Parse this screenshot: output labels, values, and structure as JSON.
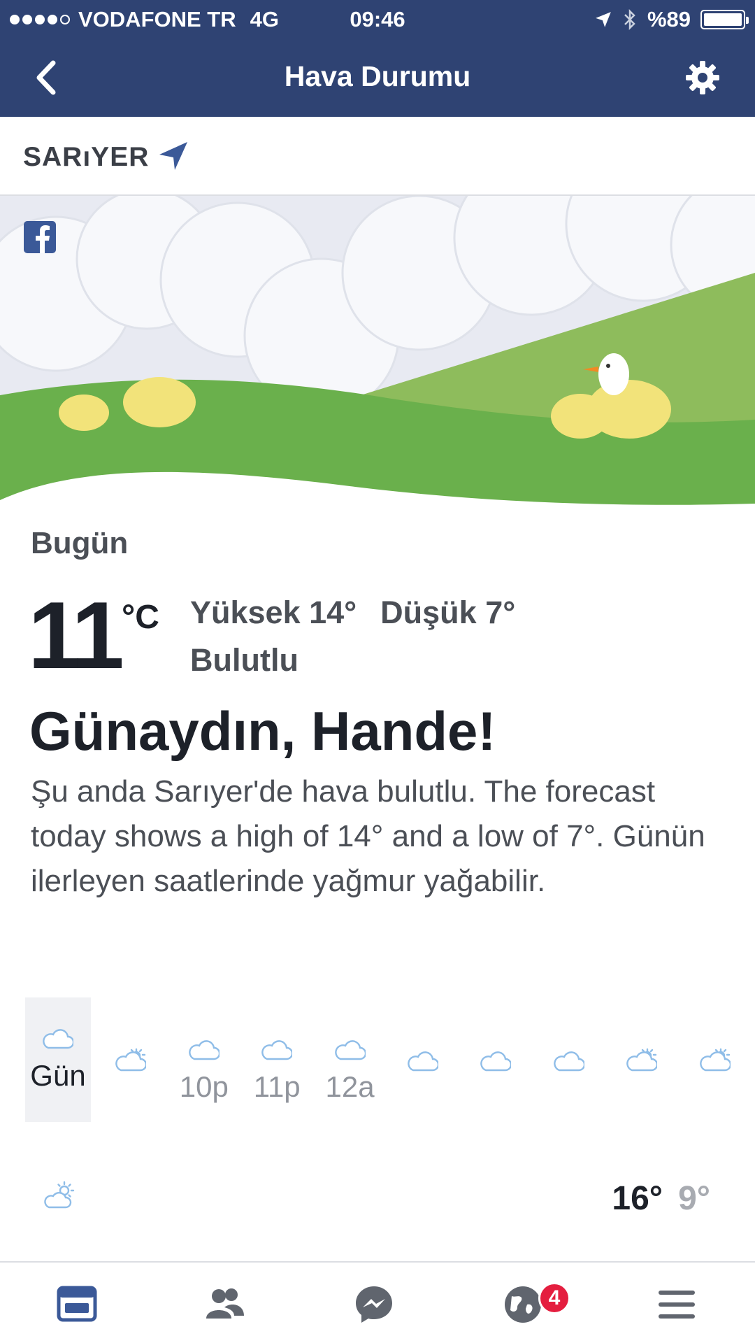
{
  "status_bar": {
    "carrier": "VODAFONE TR",
    "network": "4G",
    "time": "09:46",
    "battery": "%89",
    "signal_bars": 4
  },
  "nav": {
    "title": "Hava Durumu",
    "back_icon": "chevron-left-icon",
    "settings_icon": "gear-icon"
  },
  "location": {
    "name": "SARıYER",
    "icon": "location-arrow-icon"
  },
  "today": {
    "label": "Bugün",
    "temp": "11",
    "unit": "°C",
    "high": "Yüksek 14°",
    "low": "Düşük 7°",
    "condition": "Bulutlu",
    "greeting": "Günaydın, Hande!",
    "description": "Şu anda Sarıyer'de hava bulutlu. The forecast today shows a high of 14° and a low of 7°. Günün ilerleyen saatlerinde yağmur yağabilir."
  },
  "hourly": [
    {
      "label": "Gün",
      "icon": "cloud-icon",
      "selected": true
    },
    {
      "label": "",
      "icon": "partly-sunny-icon"
    },
    {
      "label": "10p",
      "icon": "cloud-icon"
    },
    {
      "label": "11p",
      "icon": "cloud-icon"
    },
    {
      "label": "12a",
      "icon": "cloud-icon"
    },
    {
      "label": "",
      "icon": "cloud-icon"
    },
    {
      "label": "",
      "icon": "cloud-icon"
    },
    {
      "label": "",
      "icon": "cloud-icon"
    },
    {
      "label": "",
      "icon": "partly-sunny-icon"
    },
    {
      "label": "",
      "icon": "partly-sunny-icon"
    }
  ],
  "daily": {
    "icon": "partly-sunny-icon",
    "high": "16°",
    "low": "9°"
  },
  "tab_bar": {
    "items": [
      "news-feed-icon",
      "friends-icon",
      "messenger-icon",
      "notifications-globe-icon",
      "menu-icon"
    ],
    "notification_badge": "4"
  },
  "colors": {
    "header": "#2f4373",
    "accent": "#3b5998",
    "badge": "#e41e3f",
    "weather_icon": "#8fbde8"
  }
}
